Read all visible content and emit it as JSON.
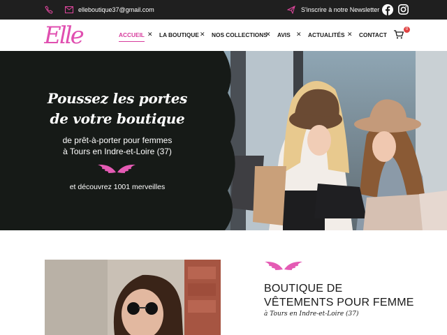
{
  "topbar": {
    "email": "elleboutique37@gmail.com",
    "newsletter": "S'inscrire à notre Newsletter",
    "icons": [
      "phone-icon",
      "mail-icon",
      "send-icon",
      "facebook-icon",
      "instagram-icon"
    ]
  },
  "nav": {
    "logo": "Elle",
    "items": [
      {
        "label": "ACCUEIL",
        "active": true
      },
      {
        "label": "LA BOUTIQUE",
        "active": false
      },
      {
        "label": "NOS COLLECTIONS",
        "active": false
      },
      {
        "label": "AVIS",
        "active": false
      },
      {
        "label": "ACTUALITÉS",
        "active": false
      },
      {
        "label": "CONTACT",
        "active": false
      }
    ],
    "cart_count": "0"
  },
  "hero": {
    "title_line1": "Poussez les portes",
    "title_line2": "de votre boutique",
    "subtitle_line1": "de prêt-à-porter pour femmes",
    "subtitle_line2": "à Tours en Indre-et-Loire (37)",
    "tagline": "et découvrez 1001 merveilles"
  },
  "section": {
    "title_line1": "BOUTIQUE DE",
    "title_line2": "VÊTEMENTS POUR FEMME",
    "subtitle": "à Tours en Indre-et-Loire (37)"
  },
  "colors": {
    "accent": "#d73c9d",
    "topbar": "#1f1f1f",
    "badge": "#e04343"
  }
}
